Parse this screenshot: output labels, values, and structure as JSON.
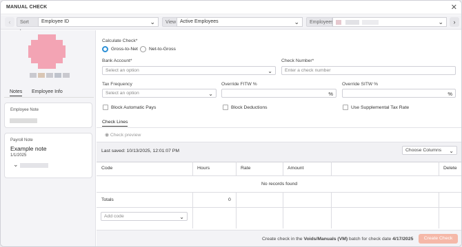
{
  "window": {
    "title": "MANUAL CHECK"
  },
  "filter_bar": {
    "sort_label": "Sort by",
    "sort_value": "Employee ID",
    "view_label": "View",
    "view_value": "Active Employees",
    "employees_label": "Employees"
  },
  "left_panel": {
    "tabs": [
      "Notes",
      "Employee Info"
    ],
    "employee_note_label": "Employee Note",
    "payroll_note_label": "Payroll Note",
    "payroll_note_title": "Example note",
    "payroll_note_date": "1/1/2025"
  },
  "form": {
    "calculate_check_label": "Calculate Check",
    "required_mark": "*",
    "calc_options": [
      "Gross-to-Net",
      "Net-to-Gross"
    ],
    "calc_selected": "Gross-to-Net",
    "bank_account_label": "Bank Account",
    "bank_account_placeholder": "Select an option",
    "check_number_label": "Check Number",
    "check_number_placeholder": "Enter a check number",
    "tax_frequency_label": "Tax Frequency",
    "tax_frequency_placeholder": "Select an option",
    "override_fitw_label": "Override FITW %",
    "override_sitw_label": "Override SITW %",
    "block_automatic_pays": "Block Automatic Pays",
    "block_deductions": "Block Deductions",
    "use_supplemental_tax_rate": "Use Supplemental Tax Rate"
  },
  "check_lines": {
    "tab_label": "Check Lines",
    "preview_label": "Check preview",
    "last_saved": "Last saved: 10/13/2025, 12:01:07 PM",
    "choose_columns": "Choose Columns",
    "columns": [
      "Code",
      "Hours",
      "Rate",
      "Amount",
      "Delete"
    ],
    "empty_text": "No records found",
    "totals_label": "Totals",
    "totals_hours": "0",
    "add_code_placeholder": "Add code"
  },
  "footer": {
    "prefix": "Create check in the",
    "batch": "Voids/Manuals (VM)",
    "middle": "batch for check date",
    "date": "4/17/2025",
    "create_button": "Create Check"
  },
  "colors": {
    "accent": "#2a8fd6",
    "button": "#f5b8a8",
    "avatar": "#f3a4b4"
  }
}
